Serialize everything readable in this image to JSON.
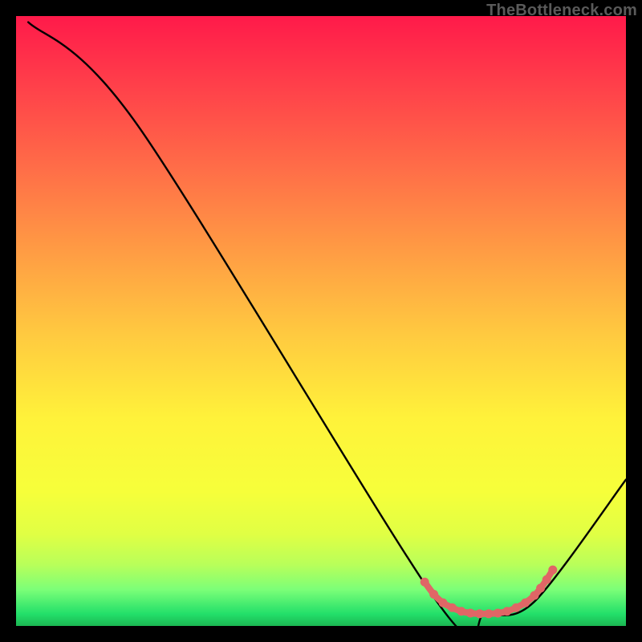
{
  "watermark": "TheBottleneck.com",
  "chart_data": {
    "type": "line",
    "title": "",
    "xlabel": "",
    "ylabel": "",
    "xlim": [
      0,
      100
    ],
    "ylim": [
      0,
      100
    ],
    "series": [
      {
        "name": "curve",
        "stroke": "#000000",
        "x": [
          2,
          20,
          69,
          77,
          85,
          100
        ],
        "y": [
          99,
          82,
          4,
          2,
          4,
          24
        ]
      }
    ],
    "highlight": {
      "name": "bottom-band",
      "stroke": "#e06666",
      "width": 8,
      "points_x": [
        67,
        68.5,
        70,
        71.5,
        73,
        74.5,
        76,
        77.5,
        79,
        80.5,
        82,
        83.5,
        85,
        86,
        87,
        88
      ],
      "points_y": [
        7.2,
        5.2,
        3.8,
        3.0,
        2.4,
        2.1,
        2.0,
        2.0,
        2.1,
        2.4,
        3.0,
        3.8,
        5.0,
        6.2,
        7.6,
        9.2
      ]
    },
    "gradient_stops": [
      {
        "pct": 0,
        "color": "#ff1a4a"
      },
      {
        "pct": 24,
        "color": "#ff6a48"
      },
      {
        "pct": 52,
        "color": "#ffc940"
      },
      {
        "pct": 78,
        "color": "#f6ff3a"
      },
      {
        "pct": 94,
        "color": "#7cff78"
      },
      {
        "pct": 100,
        "color": "#1bb652"
      }
    ]
  }
}
